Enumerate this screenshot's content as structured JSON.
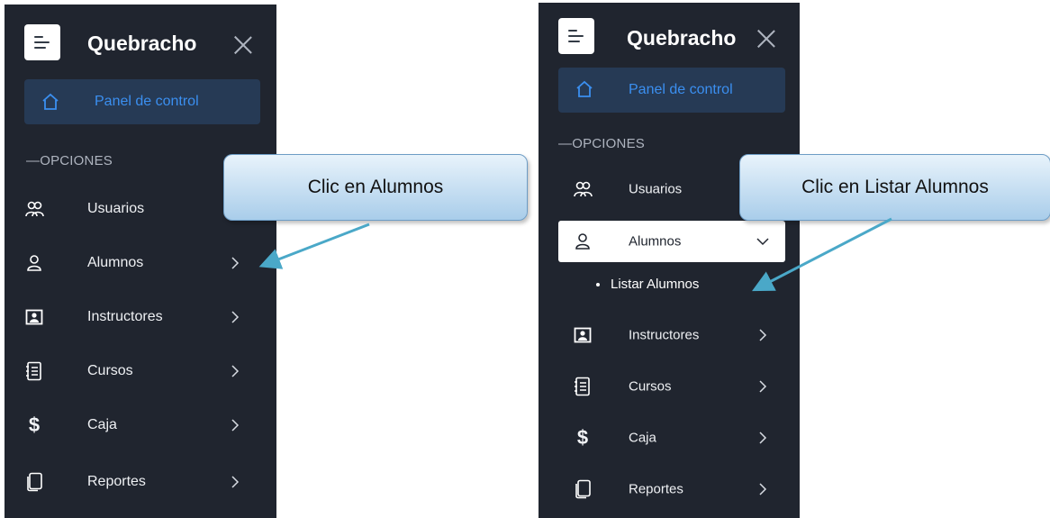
{
  "left": {
    "brand": "Quebracho",
    "panel_label": "Panel de control",
    "section": "OPCIONES",
    "items": [
      {
        "label": "Usuarios",
        "icon": "users-icon"
      },
      {
        "label": "Alumnos",
        "icon": "user-icon"
      },
      {
        "label": "Instructores",
        "icon": "id-card-icon"
      },
      {
        "label": "Cursos",
        "icon": "notebook-icon"
      },
      {
        "label": "Caja",
        "icon": "dollar-icon"
      },
      {
        "label": "Reportes",
        "icon": "copy-icon"
      }
    ],
    "callout": "Clic en Alumnos"
  },
  "right": {
    "brand": "Quebracho",
    "panel_label": "Panel de control",
    "section": "OPCIONES",
    "items": [
      {
        "label": "Usuarios",
        "icon": "users-icon"
      },
      {
        "label": "Alumnos",
        "icon": "user-icon"
      },
      {
        "label": "Instructores",
        "icon": "id-card-icon"
      },
      {
        "label": "Cursos",
        "icon": "notebook-icon"
      },
      {
        "label": "Caja",
        "icon": "dollar-icon"
      },
      {
        "label": "Reportes",
        "icon": "copy-icon"
      }
    ],
    "subitem": "Listar Alumnos",
    "callout": "Clic en Listar Alumnos"
  },
  "colors": {
    "sidebar_bg": "#20252f",
    "active_bg": "#263a55",
    "active_text": "#3b8ff0",
    "arrow": "#4aa8c8",
    "callout_border": "#6d9cc5"
  }
}
